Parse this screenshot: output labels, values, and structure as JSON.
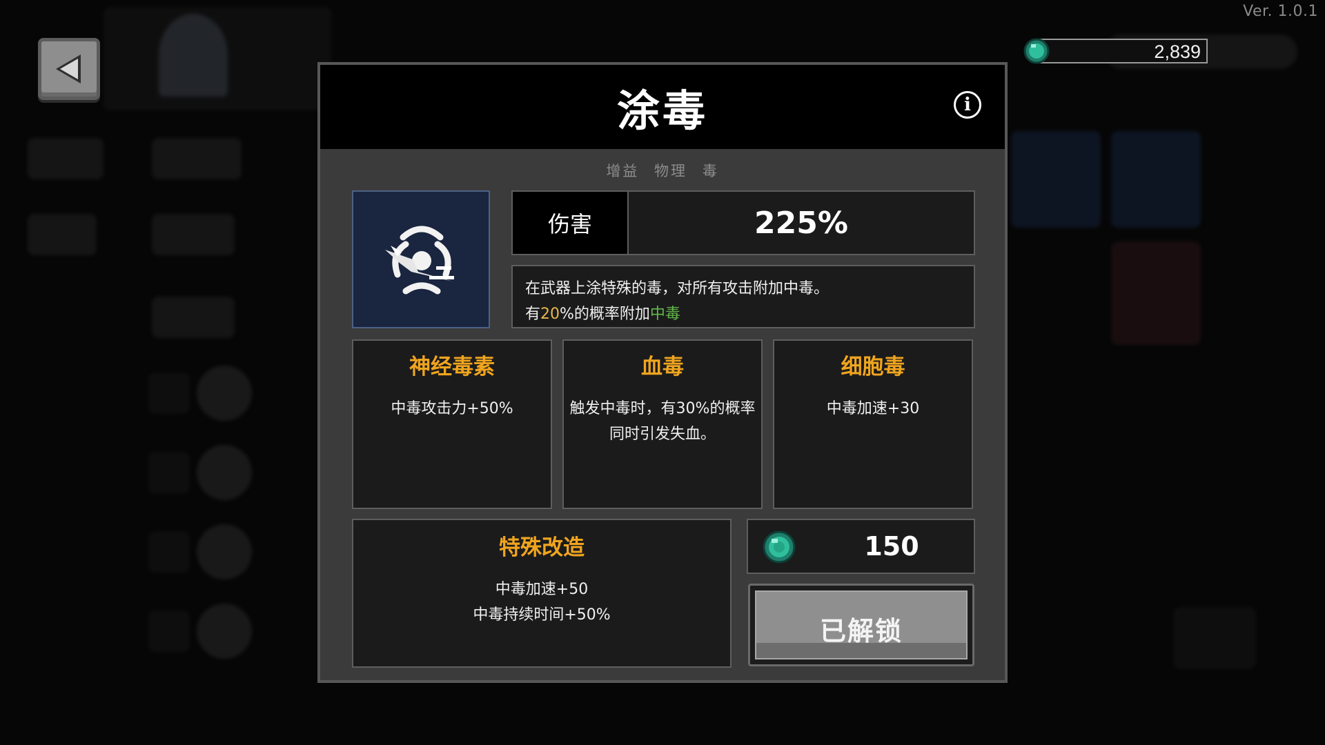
{
  "version": "Ver. 1.0.1",
  "currency": {
    "icon": "green-gem-icon",
    "amount": "2,839"
  },
  "skill": {
    "title": "涂毒",
    "tags": [
      "增益",
      "物理",
      "毒"
    ],
    "icon": "poison-biohazard-icon",
    "stat_label": "伤害",
    "stat_value": "225%",
    "description": {
      "line1": "在武器上涂特殊的毒，对所有攻击附加中毒。",
      "line2_prefix": "有",
      "line2_chance": "20",
      "line2_middle": "%的概率附加",
      "line2_effect": "中毒"
    }
  },
  "upgrades": [
    {
      "title": "神经毒素",
      "desc": "中毒攻击力+50%"
    },
    {
      "title": "血毒",
      "desc": "触发中毒时，有30%的概率同时引发失血。"
    },
    {
      "title": "细胞毒",
      "desc": "中毒加速+30"
    }
  ],
  "special": {
    "title": "特殊改造",
    "desc_line1": "中毒加速+50",
    "desc_line2": "中毒持续时间+50%"
  },
  "cost": {
    "icon": "green-gem-icon",
    "value": "150"
  },
  "unlock_button": {
    "label": "已解锁",
    "state": "disabled"
  },
  "colors": {
    "upgrade_title": "#f0a51f",
    "chance_highlight": "#e8b84a",
    "effect_highlight": "#62b84a",
    "gem": "#2fbf9c"
  }
}
